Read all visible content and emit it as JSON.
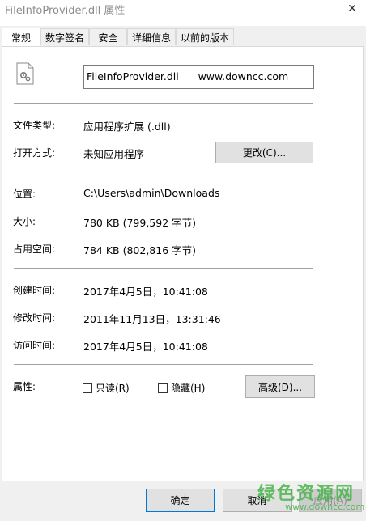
{
  "window": {
    "title": "FileInfoProvider.dll 属性"
  },
  "tabs": [
    "常规",
    "数字签名",
    "安全",
    "详细信息",
    "以前的版本"
  ],
  "general": {
    "filename": "FileInfoProvider.dll      www.downcc.com",
    "type_label": "文件类型:",
    "type_value": "应用程序扩展 (.dll)",
    "opens_label": "打开方式:",
    "opens_value": "未知应用程序",
    "change_button": "更改(C)...",
    "location_label": "位置:",
    "location_value": "C:\\Users\\admin\\Downloads",
    "size_label": "大小:",
    "size_value": "780 KB (799,592 字节)",
    "ondisk_label": "占用空间:",
    "ondisk_value": "784 KB (802,816 字节)",
    "created_label": "创建时间:",
    "created_value": "2017年4月5日，10:41:08",
    "modified_label": "修改时间:",
    "modified_value": "2011年11月13日，13:31:46",
    "accessed_label": "访问时间:",
    "accessed_value": "2017年4月5日，10:41:08",
    "attributes_label": "属性:",
    "readonly_label": "只读(R)",
    "hidden_label": "隐藏(H)",
    "advanced_button": "高级(D)..."
  },
  "footer": {
    "ok": "确定",
    "cancel": "取消",
    "apply": "应用(A)"
  },
  "watermark": {
    "brand": "绿色资源网",
    "url": "www.downcc.com"
  }
}
